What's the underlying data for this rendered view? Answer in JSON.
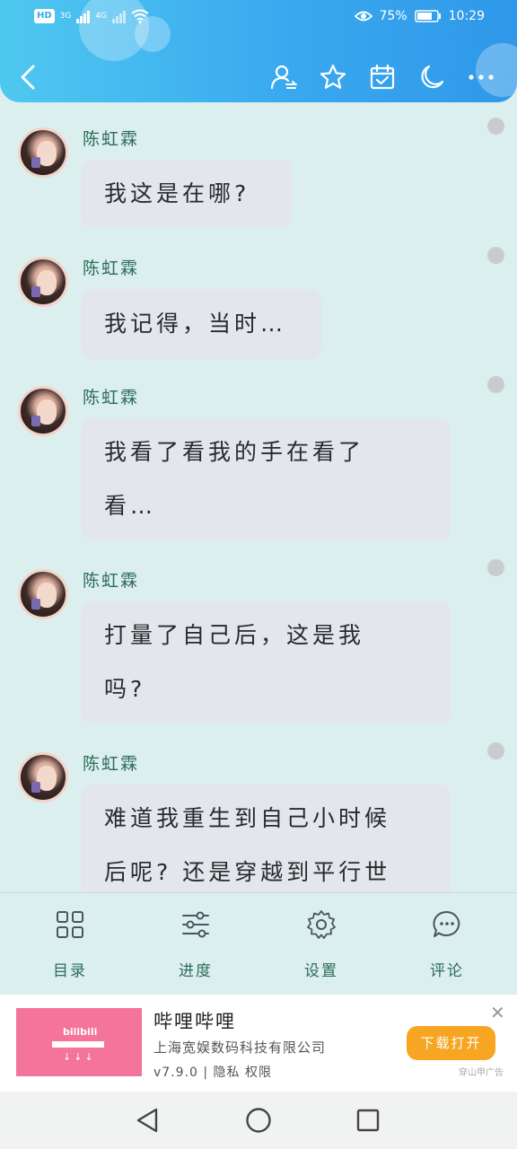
{
  "status": {
    "hd": "HD",
    "net1": "3G",
    "net2": "4G",
    "battery": "75%",
    "time": "10:29"
  },
  "header": {
    "icons": [
      "back-icon",
      "user-switch-icon",
      "star-icon",
      "calendar-check-icon",
      "moon-icon",
      "more-icon"
    ]
  },
  "messages": [
    {
      "name": "陈虹霖",
      "lines": [
        "我这是在哪?"
      ]
    },
    {
      "name": "陈虹霖",
      "lines": [
        "我记得，当时…"
      ]
    },
    {
      "name": "陈虹霖",
      "lines": [
        "我看了看我的手在看了",
        "看…"
      ]
    },
    {
      "name": "陈虹霖",
      "lines": [
        "打量了自己后，这是我",
        "吗?"
      ]
    },
    {
      "name": "陈虹霖",
      "lines": [
        "难道我重生到自己小时候",
        "后呢? 还是穿越到平行世"
      ]
    }
  ],
  "toolbar": {
    "items": [
      {
        "label": "目录",
        "icon": "grid-icon"
      },
      {
        "label": "进度",
        "icon": "sliders-icon"
      },
      {
        "label": "设置",
        "icon": "gear-icon"
      },
      {
        "label": "评论",
        "icon": "comment-icon"
      }
    ]
  },
  "ad": {
    "title": "哔哩哔哩",
    "company": "上海宽娱数码科技有限公司",
    "meta": "v7.9.0 | 隐私 权限",
    "button": "下载打开",
    "tag": "穿山甲广告",
    "logo": "bilibili"
  },
  "colors": {
    "header_gradient": "#3aa9ef",
    "background": "#dcefef",
    "name_color": "#2c6b58",
    "bubble": "#e4e6ee",
    "ad_button": "#f6a623"
  }
}
